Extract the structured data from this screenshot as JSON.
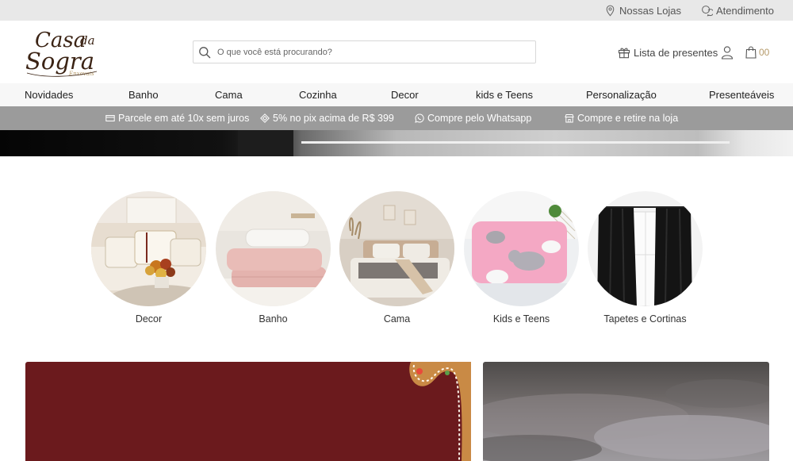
{
  "topbar": {
    "stores_label": "Nossas Lojas",
    "support_label": "Atendimento"
  },
  "header": {
    "logo": {
      "main_text": "Casa da Sogra",
      "sub_text": "Enxovais"
    },
    "search": {
      "placeholder": "O que você está procurando?",
      "value": ""
    },
    "gift_list_label": "Lista de presentes",
    "cart_count": "00"
  },
  "nav": {
    "items": [
      {
        "label": "Novidades"
      },
      {
        "label": "Banho"
      },
      {
        "label": "Cama"
      },
      {
        "label": "Cozinha"
      },
      {
        "label": "Decor"
      },
      {
        "label": "kids e Teens"
      },
      {
        "label": "Personalização"
      },
      {
        "label": "Presenteáveis"
      }
    ]
  },
  "promo": {
    "items": [
      {
        "label": "Parcele em até 10x sem juros",
        "icon": "card-icon"
      },
      {
        "label": "5% no pix acima de R$ 399",
        "icon": "pix-icon"
      },
      {
        "label": "Compre pelo Whatsapp",
        "icon": "whatsapp-icon"
      },
      {
        "label": "Compre e retire na loja",
        "icon": "store-icon"
      }
    ]
  },
  "categories": [
    {
      "label": "Decor"
    },
    {
      "label": "Banho"
    },
    {
      "label": "Cama"
    },
    {
      "label": "Kids e Teens"
    },
    {
      "label": "Tapetes e Cortinas"
    }
  ],
  "colors": {
    "brand_brown": "#3b2314",
    "brand_gold": "#b59a6a",
    "promo_bg": "#9b9b9b",
    "banner_red": "#6b1a1d",
    "topbar_bg": "#e8e8e8"
  }
}
